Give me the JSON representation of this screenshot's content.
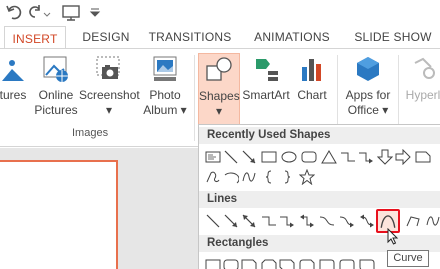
{
  "tabs": [
    {
      "label": "INSERT",
      "active": true
    },
    {
      "label": "DESIGN",
      "active": false
    },
    {
      "label": "TRANSITIONS",
      "active": false
    },
    {
      "label": "ANIMATIONS",
      "active": false
    },
    {
      "label": "SLIDE SHOW",
      "active": false
    }
  ],
  "ribbon": {
    "pictures": "tures",
    "online_pictures_1": "Online",
    "online_pictures_2": "Pictures",
    "screenshot": "Screenshot",
    "photo_album_1": "Photo",
    "photo_album_2": "Album",
    "images_group": "Images",
    "shapes": "Shapes",
    "smartart": "SmartArt",
    "chart": "Chart",
    "apps_1": "Apps for",
    "apps_2": "Office",
    "hyperlink": "Hyperl"
  },
  "gallery": {
    "recent_header": "Recently Used Shapes",
    "lines_header": "Lines",
    "rectangles_header": "Rectangles"
  },
  "tooltip": "Curve",
  "colors": {
    "accent": "#d24726",
    "highlight_box": "#e8111e",
    "shapes_button_bg": "#fcd7c8"
  }
}
